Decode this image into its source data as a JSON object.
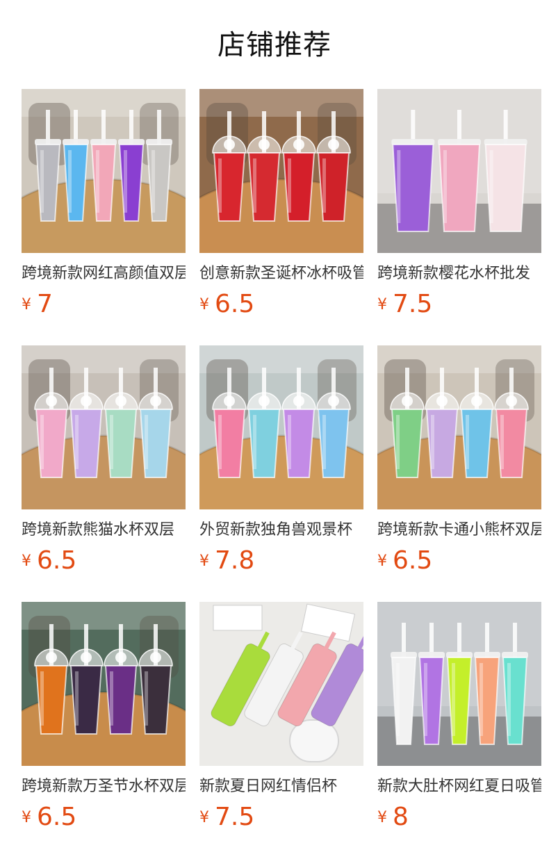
{
  "section": {
    "title": "店铺推荐"
  },
  "currency_symbol": "¥",
  "products": [
    {
      "name": "跨境新款网红高颜值双层塑料吸管杯",
      "price": "7",
      "scene": "table",
      "bg": "#cfc8bd",
      "table": "#c79a5f",
      "cups": [
        "#b9b9bf",
        "#5bb7ef",
        "#f2a7b8",
        "#8a3fd1",
        "#c9c7c4"
      ],
      "dome": false
    },
    {
      "name": "创意新款圣诞杯冰杯吸管杯",
      "price": "6.5",
      "scene": "table",
      "bg": "#8f6a4b",
      "table": "#c98e51",
      "cups": [
        "#d8262e",
        "#d52a30",
        "#d41f2a",
        "#cf2229"
      ],
      "dome": true
    },
    {
      "name": "跨境新款樱花水杯批发",
      "price": "7.5",
      "scene": "studio",
      "bg": "#d9d6d2",
      "table": "#9d9a98",
      "cups": [
        "#9b5fd8",
        "#f0a7bf",
        "#f5e3e6"
      ],
      "dome": false
    },
    {
      "name": "跨境新款熊猫水杯双层",
      "price": "6.5",
      "scene": "table",
      "bg": "#c7c0b8",
      "table": "#c59560",
      "cups": [
        "#f1a9c9",
        "#c7a9e8",
        "#a8dcc3",
        "#a6d6ea"
      ],
      "dome": true
    },
    {
      "name": "外贸新款独角兽观景杯",
      "price": "7.8",
      "scene": "table",
      "bg": "#c0c9c8",
      "table": "#cf9a5a",
      "cups": [
        "#f27ea3",
        "#7fd0df",
        "#c38be6",
        "#7ec3ee"
      ],
      "dome": true
    },
    {
      "name": "跨境新款卡通小熊杯双层",
      "price": "6.5",
      "scene": "table",
      "bg": "#cdc5b9",
      "table": "#c99459",
      "cups": [
        "#7fcf86",
        "#c7a9e2",
        "#6fc3e8",
        "#f28aa2"
      ],
      "dome": true
    },
    {
      "name": "跨境新款万圣节水杯双层",
      "price": "6.5",
      "scene": "table",
      "bg": "#536c5d",
      "table": "#c88c4b",
      "cups": [
        "#e0731d",
        "#3a2a45",
        "#6a2f86",
        "#3b2f3c"
      ],
      "dome": true
    },
    {
      "name": "新款夏日网红情侣杯",
      "price": "7.5",
      "scene": "flatlay",
      "bg": "#ecebe8",
      "table": "#e2e0dc",
      "cups": [
        "#a9dc3c",
        "#f4f4f4",
        "#f2a7ad",
        "#b08ad8"
      ],
      "dome": false
    },
    {
      "name": "新款大肚杯网红夏日吸管杯",
      "price": "8",
      "scene": "studio",
      "bg": "#bfc3c6",
      "table": "#8d8f91",
      "cups": [
        "#f2f2f2",
        "#b174e3",
        "#c4ef2a",
        "#f7a37b",
        "#69e0cf"
      ],
      "dome": false
    }
  ]
}
